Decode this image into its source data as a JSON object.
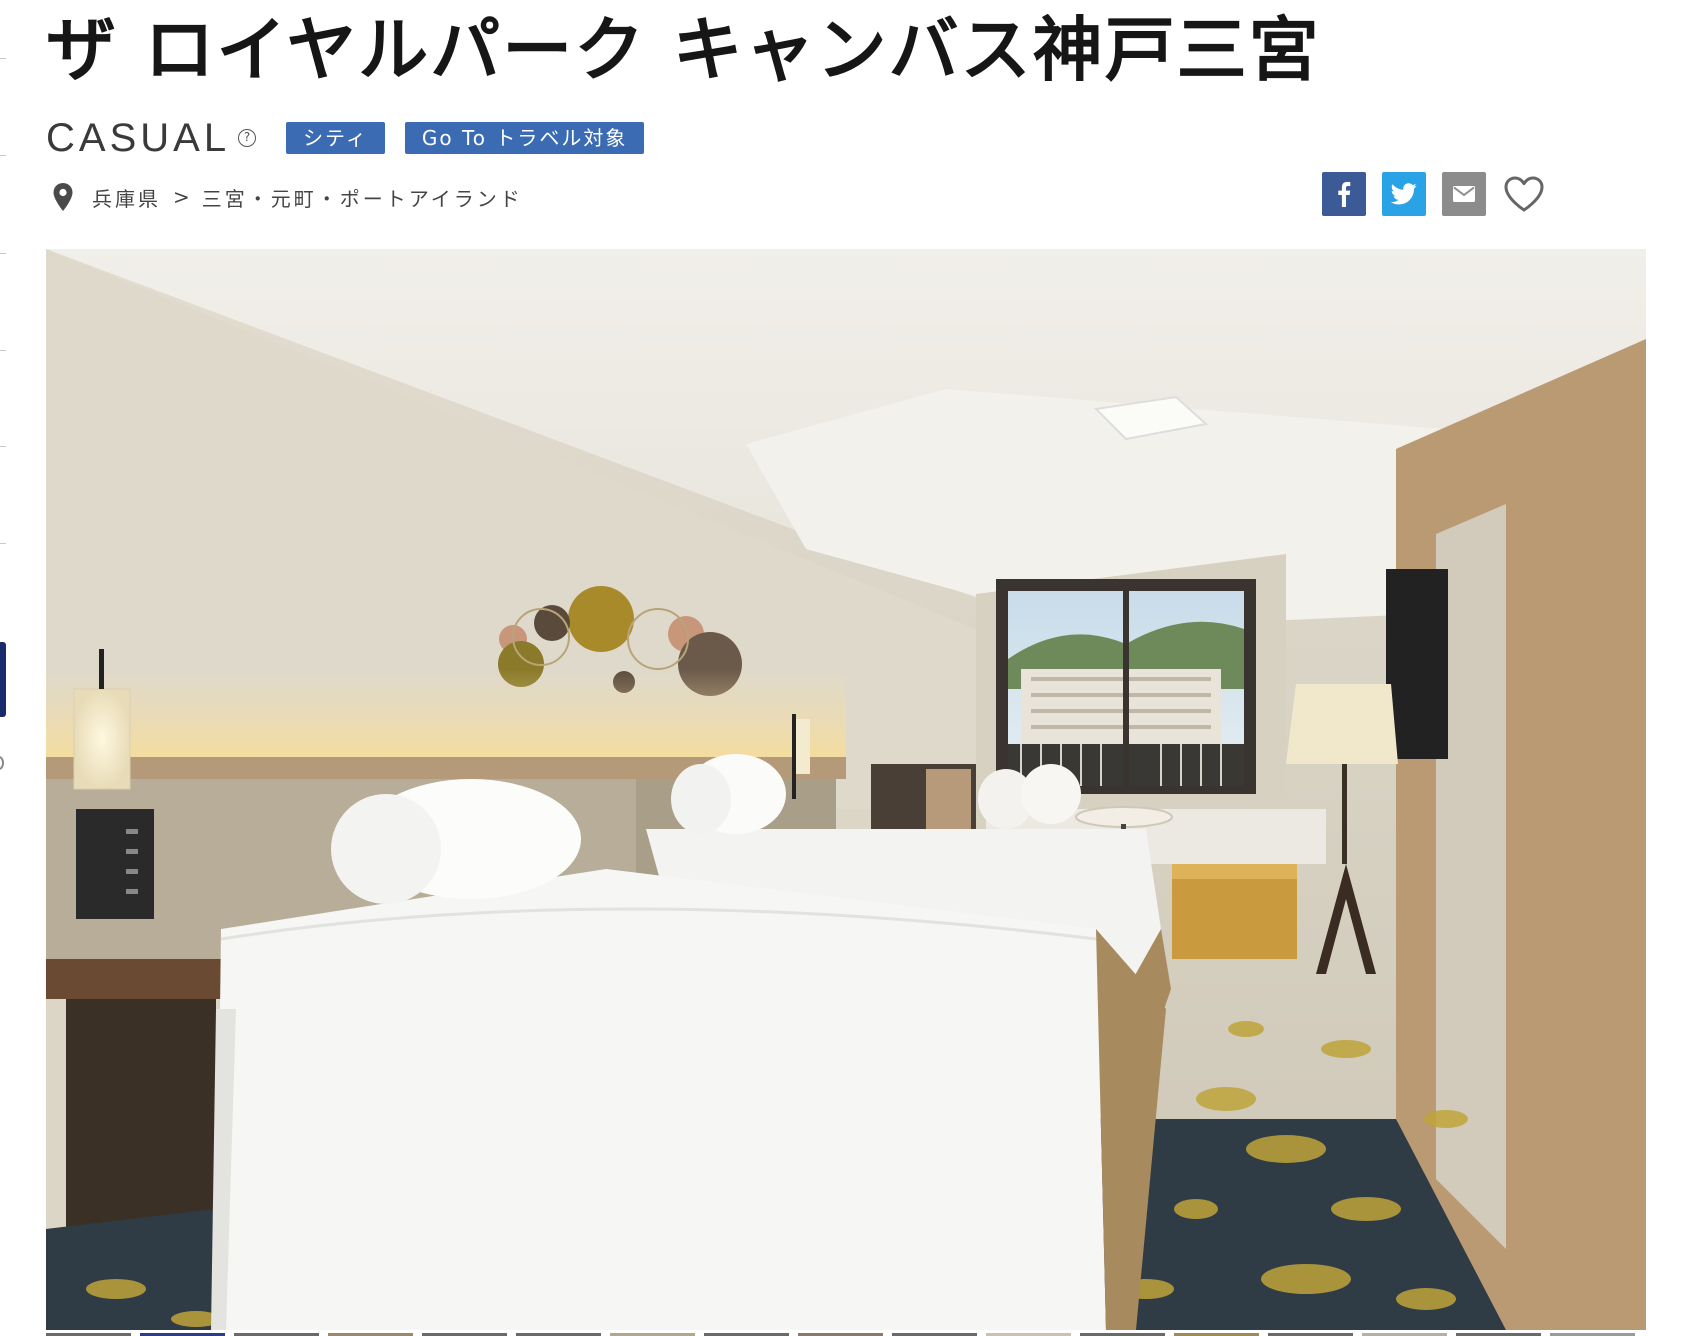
{
  "hotel": {
    "name": "ザ ロイヤルパーク キャンバス神戸三宮",
    "style": "CASUAL",
    "help_glyph": "?",
    "tags": [
      "シティ",
      "Go To トラベル対象"
    ]
  },
  "location": {
    "prefecture": "兵庫県",
    "separator": ">",
    "area": "三宮・元町・ポートアイランド"
  },
  "share": {
    "facebook_icon": "facebook-icon",
    "twitter_icon": "twitter-icon",
    "mail_icon": "mail-icon",
    "favorite_icon": "heart-outline-icon"
  },
  "colors": {
    "tag_bg": "#3a6bb3",
    "facebook": "#3b5a96",
    "twitter": "#2aa3e6",
    "mail": "#8c8c8c",
    "edge_tab": "#1b2a6b"
  },
  "gallery": {
    "main_image": "hotel-twin-room-photo",
    "thumbnail_count": 17
  }
}
